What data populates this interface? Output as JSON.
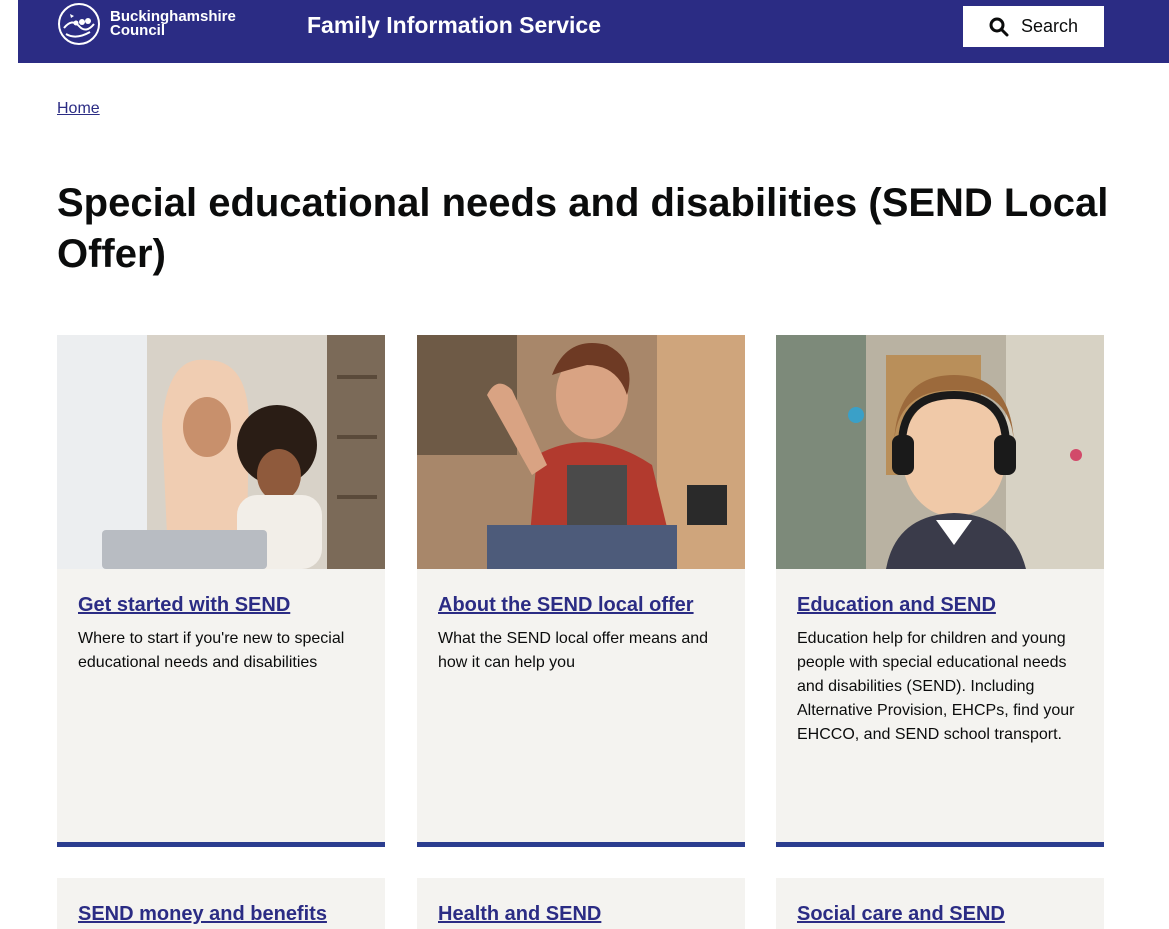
{
  "header": {
    "logo_line1": "Buckinghamshire",
    "logo_line2": "Council",
    "service_name": "Family Information Service",
    "search_label": "Search"
  },
  "breadcrumb": {
    "home": "Home"
  },
  "page_title": "Special educational needs and disabilities (SEND Local Offer)",
  "cards": [
    {
      "title": "Get started with SEND",
      "description": "Where to start if you're new to special educational needs and disabilities"
    },
    {
      "title": "About the SEND local offer",
      "description": "What the SEND local offer means and how it can help you"
    },
    {
      "title": "Education and SEND",
      "description": "Education help for children and young people with special educational needs and disabilities (SEND). Including Alternative Provision, EHCPs, find your EHCCO, and SEND school transport."
    },
    {
      "title": "SEND money and benefits"
    },
    {
      "title": "Health and SEND"
    },
    {
      "title": "Social care and SEND"
    }
  ],
  "colors": {
    "brand": "#2b2c84",
    "card_bg": "#f4f3f0",
    "card_bar": "#2b3d8f"
  }
}
